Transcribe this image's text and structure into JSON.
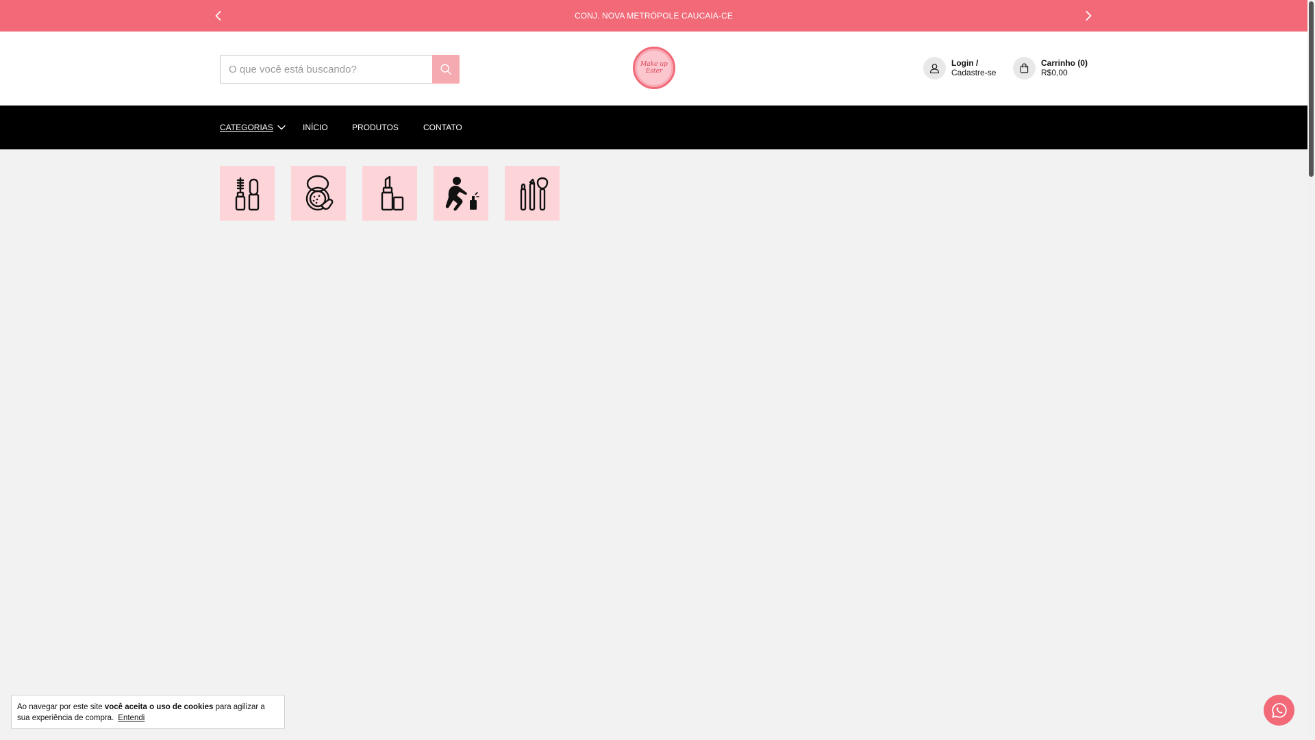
{
  "announcement": {
    "message": "CONJ. NOVA METRÓPOLE CAUCAIA-CE",
    "prev_icon": "chevron-left-icon",
    "next_icon": "chevron-right-icon"
  },
  "header": {
    "search": {
      "placeholder": "O que você está buscando?",
      "value": "",
      "icon": "search-icon"
    },
    "logo": {
      "line1": "Make up",
      "line2": "Ester"
    },
    "account": {
      "title": "Login /",
      "subtitle": "Cadastre-se",
      "icon": "user-icon"
    },
    "cart": {
      "title": "Carrinho (0)",
      "subtitle": "R$0,00",
      "icon": "shopping-bag-icon"
    }
  },
  "nav": {
    "categories": "CATEGORIAS",
    "items": [
      "INÍCIO",
      "PRODUTOS",
      "CONTATO"
    ]
  },
  "category_tiles": [
    {
      "icon": "mascara-icon"
    },
    {
      "icon": "powder-compact-icon"
    },
    {
      "icon": "lipstick-icon"
    },
    {
      "icon": "body-care-icon"
    },
    {
      "icon": "makeup-brushes-icon"
    }
  ],
  "cookie_notice": {
    "text_before": "Ao navegar por este site ",
    "text_bold": "você aceita o uso de cookies",
    "text_after": " para agilizar a sua experiência de compra.",
    "accept_label": "Entendi"
  },
  "colors": {
    "brand_pink": "#f26978",
    "tile_pink": "#fdd4d8",
    "nav_black": "#000000"
  }
}
